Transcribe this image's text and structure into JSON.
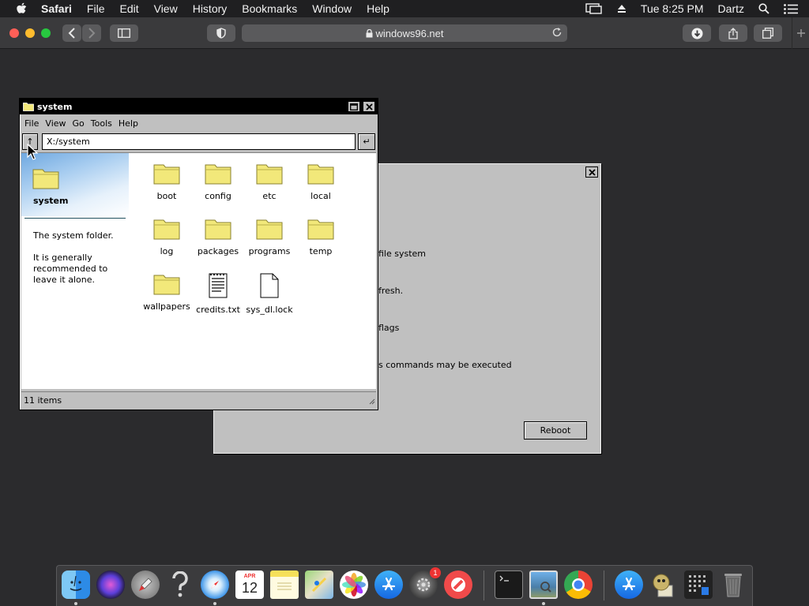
{
  "menubar": {
    "app": "Safari",
    "items": [
      "File",
      "Edit",
      "View",
      "History",
      "Bookmarks",
      "Window",
      "Help"
    ],
    "datetime": "Tue 8:25 PM",
    "user": "Dartz"
  },
  "safari": {
    "url": "windows96.net"
  },
  "back_window": {
    "lines": [
      "file system",
      "fresh.",
      "flags",
      "s commands may be executed"
    ],
    "reboot_label": "Reboot"
  },
  "file_manager": {
    "title": "system",
    "menu": [
      "File",
      "View",
      "Go",
      "Tools",
      "Help"
    ],
    "up_label": "↑",
    "path": "X:/system",
    "go_label": "↵",
    "sidebar": {
      "title": "system",
      "desc1": "The system folder.",
      "desc2": "It is generally recommended to leave it alone."
    },
    "items": [
      {
        "name": "boot",
        "type": "folder"
      },
      {
        "name": "config",
        "type": "folder"
      },
      {
        "name": "etc",
        "type": "folder"
      },
      {
        "name": "local",
        "type": "folder"
      },
      {
        "name": "log",
        "type": "folder"
      },
      {
        "name": "packages",
        "type": "folder"
      },
      {
        "name": "programs",
        "type": "folder"
      },
      {
        "name": "temp",
        "type": "folder"
      },
      {
        "name": "wallpapers",
        "type": "folder"
      },
      {
        "name": "credits.txt",
        "type": "text-file"
      },
      {
        "name": "sys_dl.lock",
        "type": "file"
      }
    ],
    "status": "11 items"
  },
  "dock": {
    "calendar_month": "APR",
    "calendar_day": "12",
    "settings_badge": "1",
    "apps": [
      "finder-icon",
      "siri-icon",
      "launchpad-icon",
      "help-icon",
      "safari-icon",
      "calendar-icon",
      "notes-icon",
      "maps-icon",
      "photos-icon",
      "app-store-icon",
      "system-preferences-icon",
      "news-icon",
      "terminal-icon",
      "preview-icon",
      "chrome-icon",
      "app-store-icon-2",
      "automator-icon",
      "grid-app-icon",
      "trash-icon"
    ]
  },
  "colors": {
    "win_gray": "#c0c0c0",
    "folder_yellow": "#f2e87a",
    "desktop_bg": "#2b2b2d"
  }
}
